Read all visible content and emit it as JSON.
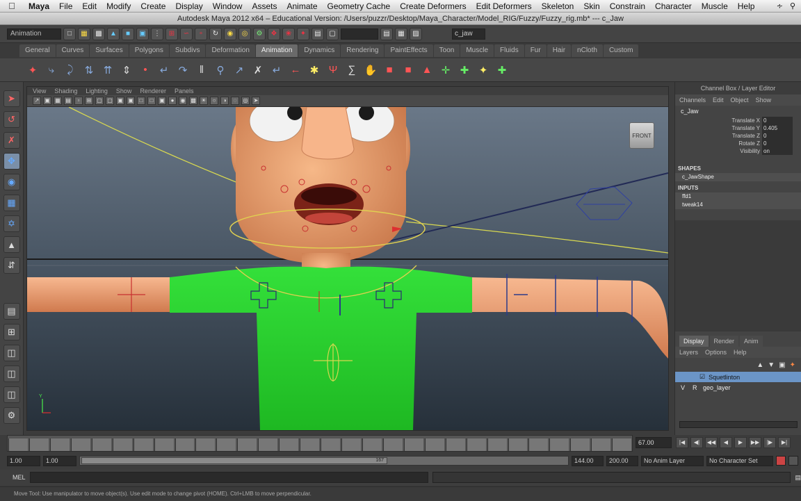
{
  "menubar": {
    "app": "Maya",
    "items": [
      "File",
      "Edit",
      "Modify",
      "Create",
      "Display",
      "Window",
      "Assets",
      "Animate",
      "Geometry Cache",
      "Create Deformers",
      "Edit Deformers",
      "Skeleton",
      "Skin",
      "Constrain",
      "Character",
      "Muscle",
      "Help"
    ]
  },
  "title": "Autodesk Maya 2012 x64 – Educational Version: /Users/puzzr/Desktop/Maya_Character/Model_RIG/Fuzzy/Fuzzy_rig.mb*   ---   c_Jaw",
  "status_line": {
    "mode": "Animation",
    "name_field": "c_jaw"
  },
  "shelf_tabs": [
    {
      "label": "General",
      "active": false
    },
    {
      "label": "Curves",
      "active": false
    },
    {
      "label": "Surfaces",
      "active": false
    },
    {
      "label": "Polygons",
      "active": false
    },
    {
      "label": "Subdivs",
      "active": false
    },
    {
      "label": "Deformation",
      "active": false
    },
    {
      "label": "Animation",
      "active": true
    },
    {
      "label": "Dynamics",
      "active": false
    },
    {
      "label": "Rendering",
      "active": false
    },
    {
      "label": "PaintEffects",
      "active": false
    },
    {
      "label": "Toon",
      "active": false
    },
    {
      "label": "Muscle",
      "active": false
    },
    {
      "label": "Fluids",
      "active": false
    },
    {
      "label": "Fur",
      "active": false
    },
    {
      "label": "Hair",
      "active": false
    },
    {
      "label": "nCloth",
      "active": false
    },
    {
      "label": "Custom",
      "active": false
    }
  ],
  "viewport_menu": [
    "View",
    "Shading",
    "Lighting",
    "Show",
    "Renderer",
    "Panels"
  ],
  "view_cube_label": "FRONT",
  "channel_box": {
    "header": "Channel Box / Layer Editor",
    "menu": [
      "Channels",
      "Edit",
      "Object",
      "Show"
    ],
    "object": "c_Jaw",
    "attributes": [
      {
        "name": "Translate X",
        "value": "0"
      },
      {
        "name": "Translate Y",
        "value": "0.405"
      },
      {
        "name": "Translate Z",
        "value": "0"
      },
      {
        "name": "Rotate Z",
        "value": "0"
      },
      {
        "name": "Visibility",
        "value": "on"
      }
    ],
    "shapes_label": "SHAPES",
    "shape_item": "c_JawShape",
    "inputs_label": "INPUTS",
    "input_items": [
      "ffd1",
      "tweak14"
    ]
  },
  "layer_editor": {
    "tabs": [
      {
        "label": "Display",
        "active": true
      },
      {
        "label": "Render",
        "active": false
      },
      {
        "label": "Anim",
        "active": false
      }
    ],
    "menu": [
      "Layers",
      "Options",
      "Help"
    ],
    "layers": [
      {
        "v": "",
        "p": "",
        "name": "Squetlinton",
        "selected": true
      },
      {
        "v": "V",
        "p": "R",
        "name": "geo_layer",
        "selected": false
      }
    ]
  },
  "timeline": {
    "current_frame": "67.00",
    "range_start": "1.00",
    "range_inner_start": "1.00",
    "range_inner_end": "167",
    "range_end_outer": "144.00",
    "range_end_total": "200.00",
    "anim_layer": "No Anim Layer",
    "character_set": "No Character Set"
  },
  "command_line": {
    "label": "MEL"
  },
  "help_line": "Move Tool: Use manipulator to move object(s). Use edit mode to change pivot (HOME). Ctrl+LMB to move perpendicular.",
  "colors": {
    "shirt": "#27d12a",
    "skin": "#f0a070",
    "bg": "#3c3c3c",
    "selection": "#6b95c7"
  }
}
